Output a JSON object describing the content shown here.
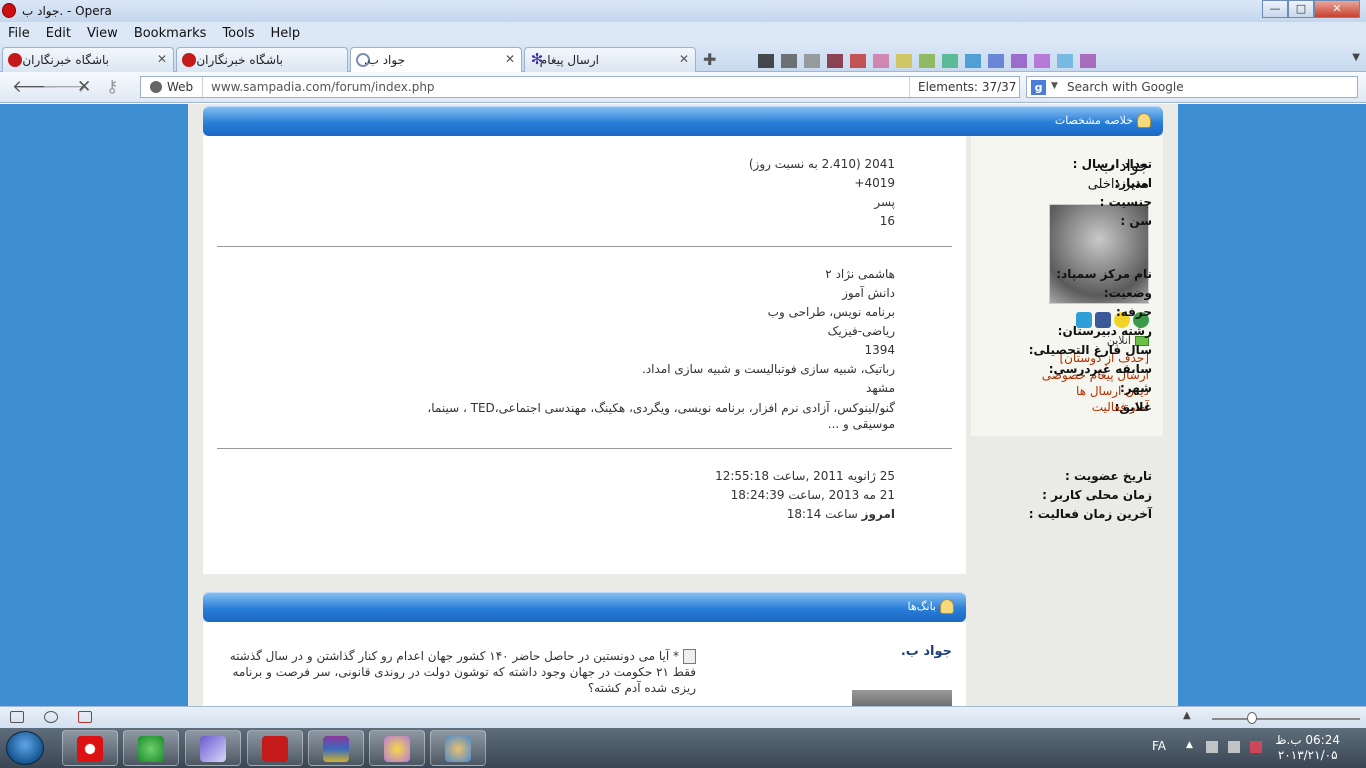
{
  "window": {
    "title": "جواد ب. - Opera",
    "buttons": {
      "minimize": "—",
      "maximize": "□",
      "close": "✕"
    }
  },
  "menu": [
    "File",
    "Edit",
    "View",
    "Bookmarks",
    "Tools",
    "Help"
  ],
  "tabs": [
    {
      "label": "باشگاه خبرنگاران",
      "icon": "opera-speed-icon",
      "color": "#c41a1a"
    },
    {
      "label": "باشگاه خبرنگاران",
      "icon": "opera-speed-icon",
      "color": "#c41a1a"
    },
    {
      "label": "جواد ب.",
      "icon": "loading-icon",
      "color": "#7a8fb0",
      "active": true
    },
    {
      "label": "ارسال پیغام",
      "icon": "asterisk-icon",
      "color": "#3a2fa0"
    }
  ],
  "tab_swatch_colors": [
    "#202020",
    "#555",
    "#888",
    "#7a1a2a",
    "#c03030",
    "#d070a0",
    "#d0c040",
    "#80b040",
    "#40b080",
    "#3090d0",
    "#5070d0",
    "#9050c0",
    "#b060d0",
    "#60b0e0",
    "#a050b0"
  ],
  "address_bar": {
    "web_label": "Web",
    "url": "www.sampadia.com/forum/index.php",
    "elements_label": "Elements:",
    "elements_count": "37/37"
  },
  "search": {
    "engine": "g",
    "placeholder": "Search with Google"
  },
  "summary_header": "خلاصه مشخصات",
  "profile": {
    "name": "جواد ب.",
    "role": "مدیر داخلی",
    "online": "آنلاین",
    "links": [
      "[حذف از دوستان]",
      "ارسال پیغام خصوصی",
      "دیدن ارسال ها",
      "آمار فعالیت"
    ]
  },
  "stats": [
    {
      "label": "تعداد ارسال :",
      "value": "2041 (2.410 به نسبت روز)"
    },
    {
      "label": "امتیاز:",
      "value": "4019+"
    },
    {
      "label": "جنسیت :",
      "value": "پسر"
    },
    {
      "label": "سن :",
      "value": "16"
    }
  ],
  "details": [
    {
      "label": "نام مرکز سمپاد:",
      "value": "هاشمی نژاد ۲"
    },
    {
      "label": "وضعیت:",
      "value": "دانش آموز"
    },
    {
      "label": "حرفه:",
      "value": "برنامه نویس، طراحی وب"
    },
    {
      "label": "رشته دبیرستان:",
      "value": "ریاضی-فیزیک"
    },
    {
      "label": "سال فارغ التحصیلی:",
      "value": "1394"
    },
    {
      "label": "سابقه غیردرسی:",
      "value": "رباتیک، شبیه سازی فوتبالیست و شبیه سازی امداد."
    },
    {
      "label": "شهر:",
      "value": "مشهد"
    },
    {
      "label": "علایق:",
      "value": "گنو/لینوکس، آزادی نرم افزار، برنامه نویسی، ویگردی، هکینگ، مهندسی اجتماعی،TED ، سینما، موسیقی و ..."
    }
  ],
  "times": [
    {
      "label": "تاریخ عضویت :",
      "value": "25 ژانویه 2011 ,ساعت 12:55:18"
    },
    {
      "label": "زمان محلی کاربر :",
      "value": "21 مه 2013 ,ساعت 18:24:39"
    },
    {
      "label": "آخرین زمان فعالیت :",
      "value_bold": "امروز",
      "value": "ساعت 18:14"
    }
  ],
  "shouts_header": "بانگ‌ها",
  "shout": {
    "author": "جواد ب.",
    "text": "* آیا می دونستین در حاصل حاضر ۱۴۰ کشور جهان اعدام رو کنار گذاشتن و در سال گذشته فقط ۲۱ حکومت در جهان وجود داشته که توشون دولت در روندی قانونی، سر فرصت و برنامه ریزی شده آدم کشته؟"
  },
  "colors": {
    "page_bg": "#3d8ed2",
    "link": "#b03000",
    "bar": "#2a7fd8"
  },
  "taskbar": {
    "apps": [
      "opera-icon",
      "download-manager-icon",
      "media-player-icon",
      "pdf-reader-icon",
      "winrar-icon",
      "messenger-icon",
      "paint-icon"
    ],
    "lang": "FA",
    "time": "06:24 ب.ظ",
    "date": "۲۰۱۳/۲۱/۰۵"
  }
}
